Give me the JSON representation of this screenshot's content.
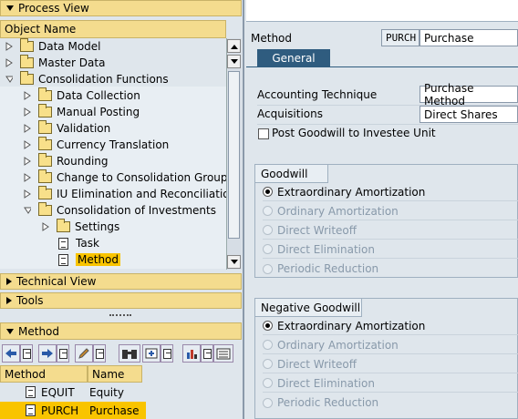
{
  "left": {
    "process_view_label": "Process View",
    "column_header": "Object Name",
    "tree": [
      {
        "label": "Data Model"
      },
      {
        "label": "Master Data"
      },
      {
        "label": "Consolidation Functions"
      },
      {
        "label": "Data Collection"
      },
      {
        "label": "Manual Posting"
      },
      {
        "label": "Validation"
      },
      {
        "label": "Currency Translation"
      },
      {
        "label": "Rounding"
      },
      {
        "label": "Change to Consolidation Group"
      },
      {
        "label": "IU Elimination and Reconciliation"
      },
      {
        "label": "Consolidation of Investments"
      },
      {
        "label": "Settings"
      },
      {
        "label": "Task"
      },
      {
        "label": "Method"
      }
    ],
    "technical_view_label": "Technical View",
    "tools_label": "Tools",
    "method_panel_label": "Method",
    "method_table": {
      "headers": [
        "Method",
        "Name"
      ],
      "rows": [
        {
          "method": "EQUIT",
          "name": "Equity"
        },
        {
          "method": "PURCH",
          "name": "Purchase"
        }
      ]
    }
  },
  "right": {
    "method_label": "Method",
    "method_code": "PURCH",
    "method_name": "Purchase",
    "tab_general": "General",
    "accounting_technique_label": "Accounting Technique",
    "accounting_technique_value": "Purchase Method",
    "acquisitions_label": "Acquisitions",
    "acquisitions_value": "Direct Shares",
    "post_goodwill_label": "Post Goodwill to Investee Unit",
    "goodwill_group": {
      "title": "Goodwill",
      "options": [
        "Extraordinary Amortization",
        "Ordinary Amortization",
        "Direct Writeoff",
        "Direct Elimination",
        "Periodic Reduction"
      ]
    },
    "negative_goodwill_group": {
      "title": "Negative Goodwill",
      "options": [
        "Extraordinary Amortization",
        "Ordinary Amortization",
        "Direct Writeoff",
        "Direct Elimination",
        "Periodic Reduction"
      ]
    }
  }
}
